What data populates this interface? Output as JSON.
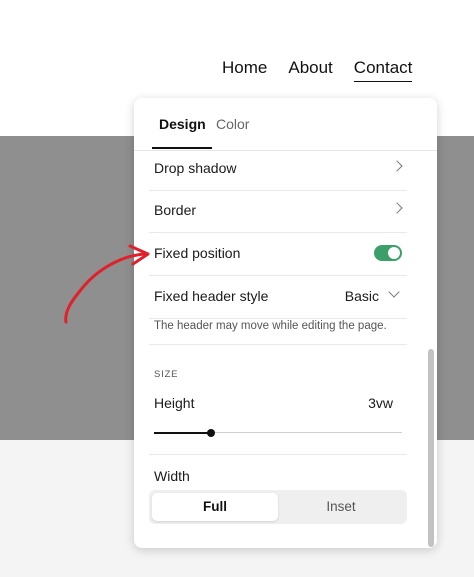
{
  "nav": {
    "links": [
      {
        "label": "Home"
      },
      {
        "label": "About"
      },
      {
        "label": "Contact"
      }
    ]
  },
  "panel": {
    "tabs": [
      {
        "label": "Design",
        "active": true
      },
      {
        "label": "Color",
        "active": false
      }
    ],
    "rows": {
      "drop_shadow": "Drop shadow",
      "border": "Border",
      "fixed_position": "Fixed position",
      "fixed_position_on": true,
      "fixed_header_style": "Fixed header style",
      "fixed_header_style_value": "Basic"
    },
    "helper_text": "The header may move while editing the page.",
    "size_section": "SIZE",
    "height_label": "Height",
    "height_value": "3vw",
    "height_slider_fraction": 0.23,
    "width_label": "Width",
    "width_options": [
      "Full",
      "Inset"
    ],
    "width_selected": "Full"
  },
  "colors": {
    "toggle_on": "#3c9f6a",
    "annotation": "#e0202a",
    "site_band": "#8f8f8f"
  }
}
